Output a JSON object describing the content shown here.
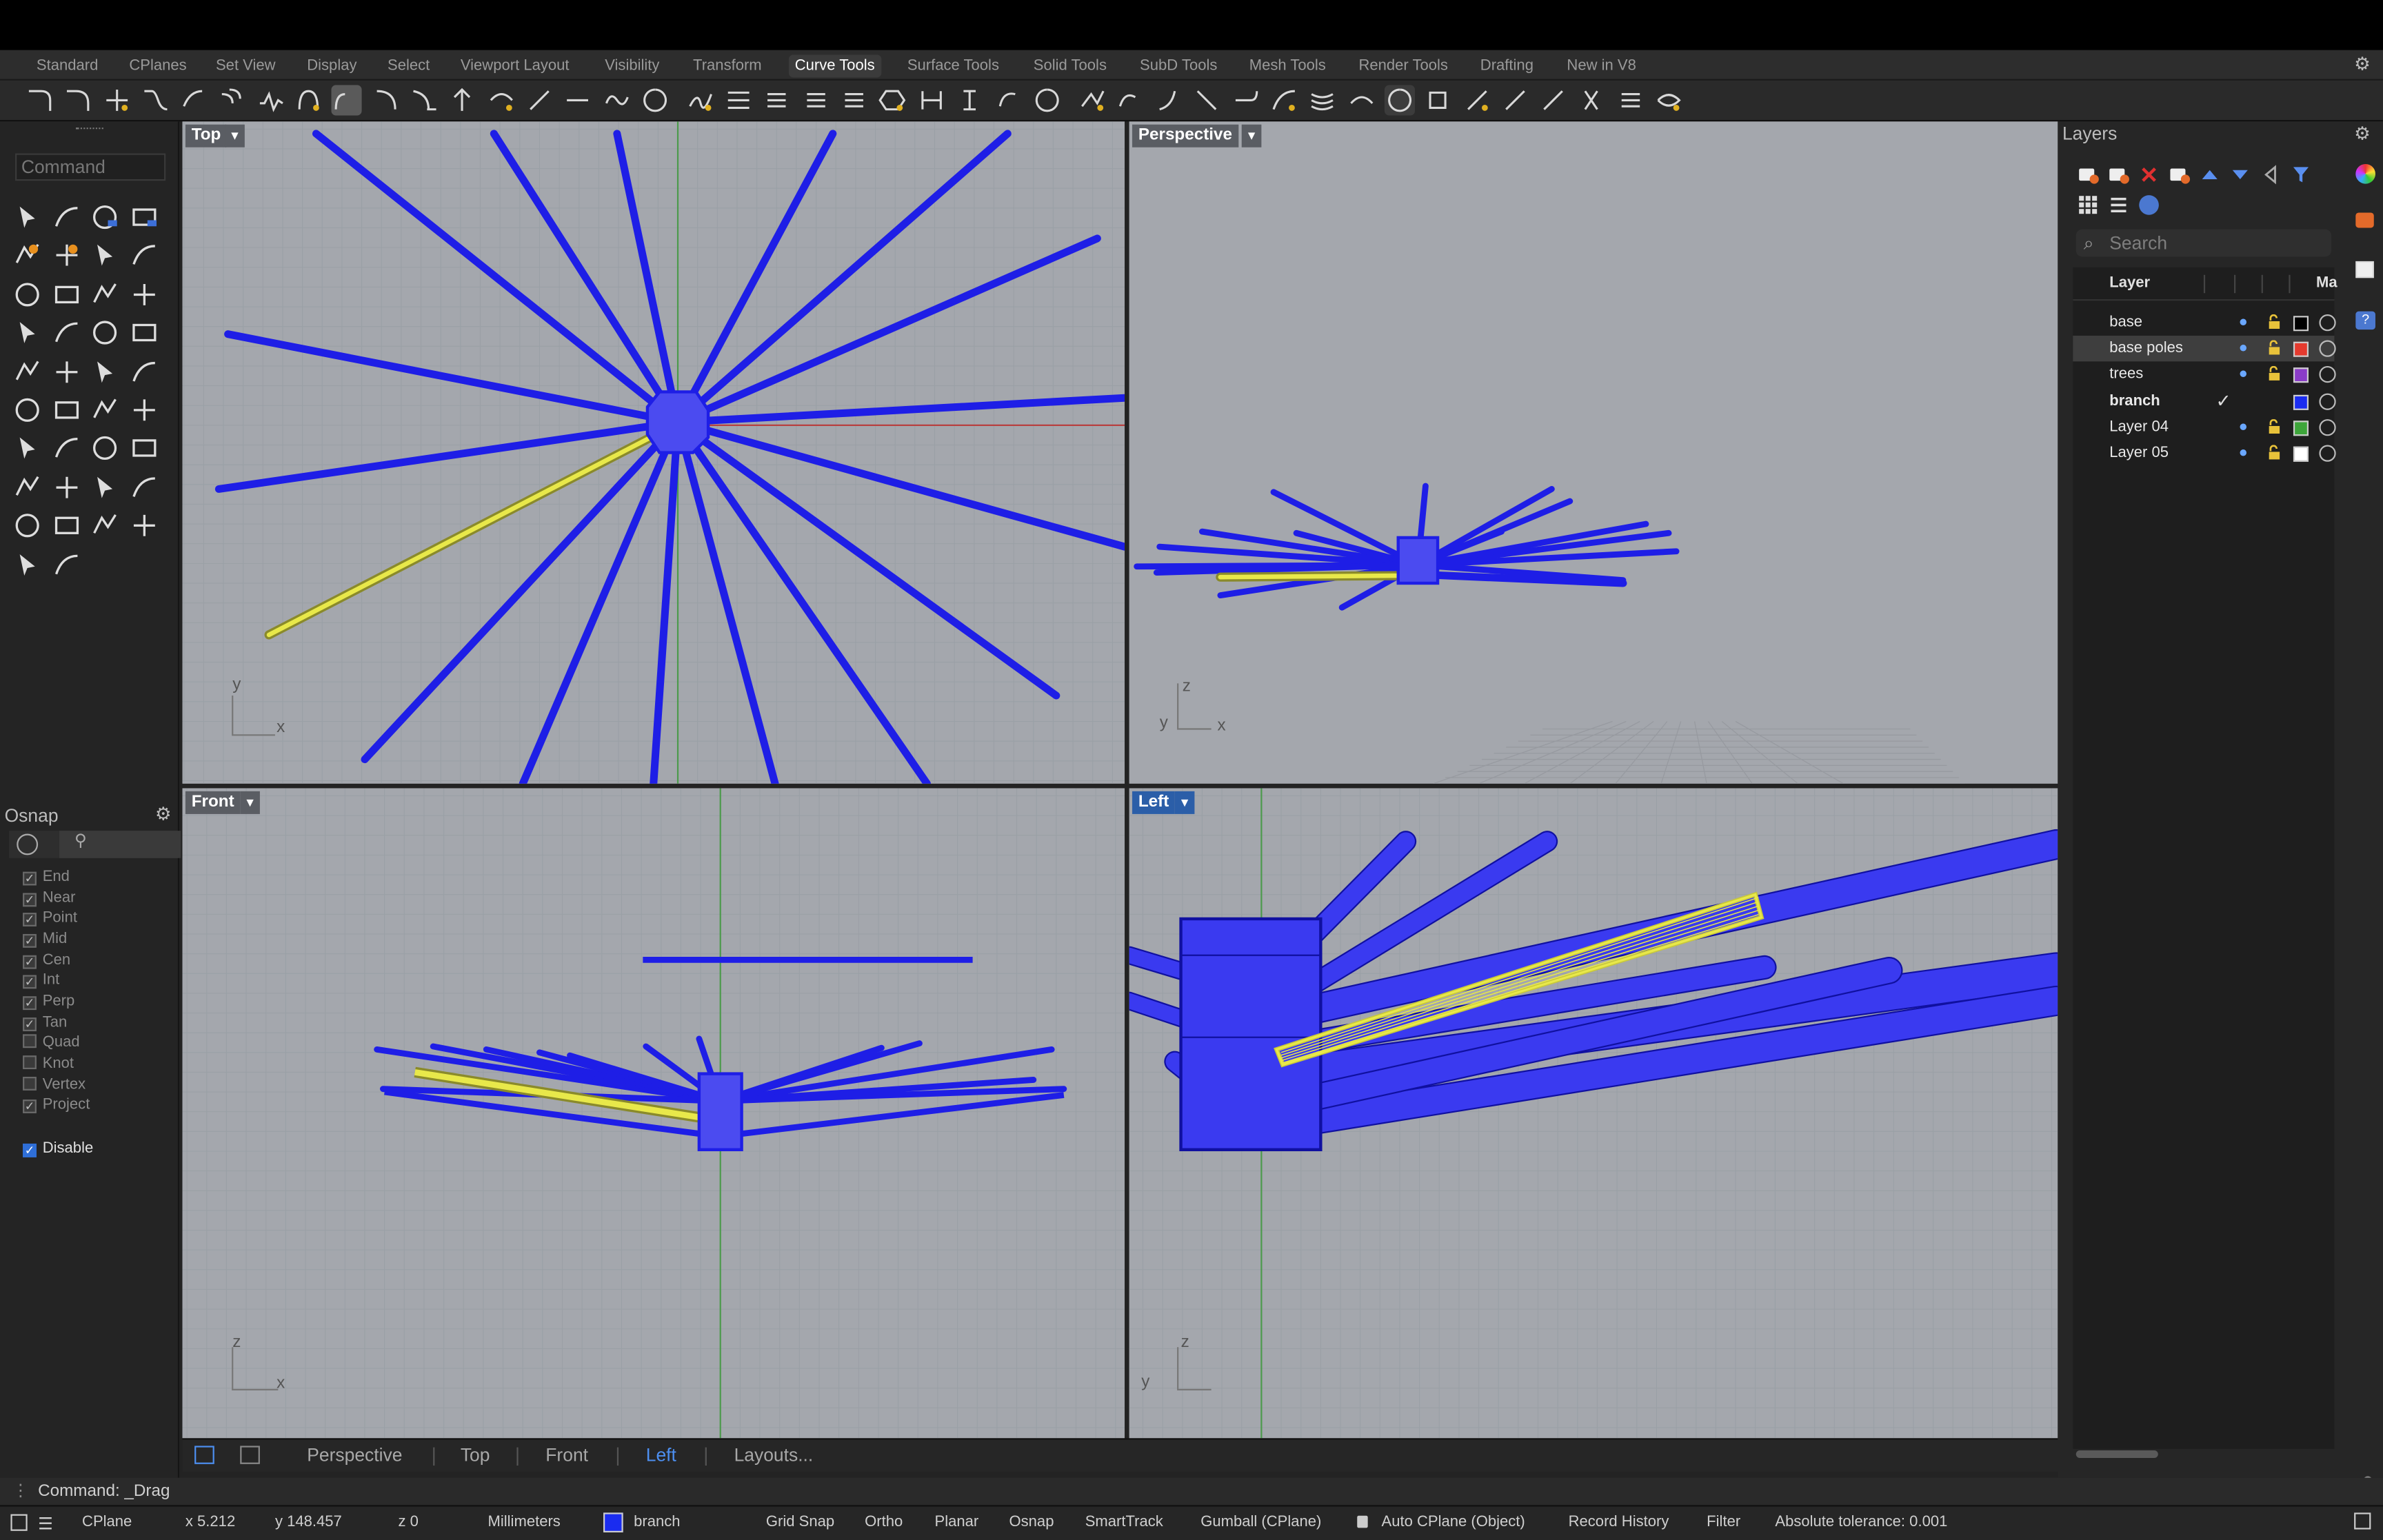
{
  "menu_tabs": [
    "Standard",
    "CPlanes",
    "Set View",
    "Display",
    "Select",
    "Viewport Layout",
    "Visibility",
    "Transform",
    "Curve Tools",
    "Surface Tools",
    "Solid Tools",
    "SubD Tools",
    "Mesh Tools",
    "Render Tools",
    "Drafting",
    "New in V8"
  ],
  "active_tab": "Curve Tools",
  "command_placeholder": "Command",
  "toolbar_icons": [
    "fillet-curves-icon",
    "chamfer-curves-icon",
    "connect-icon",
    "blend-curves-icon",
    "adjustable-blend-icon",
    "offset-curve-icon",
    "curve-from-2-views-icon",
    "arc-blend-icon",
    "match-curve-icon",
    "curve-boolean-icon",
    "extend-curve-icon",
    "project-icon",
    "pull-icon",
    "duplicate-edge-icon",
    "dash-icon",
    "curvature-graph-icon",
    "control-point-icon",
    "rebuild-curve-icon",
    "change-degree-icon",
    "fit-curve-icon",
    "simplify-icon",
    "fair-icon",
    "make-periodic-icon",
    "tween-curves-icon",
    "dimension-icon",
    "curve-direction-icon",
    "curve-end-icon",
    "seam-icon",
    "curve-edit-icon",
    "trim-icon",
    "split-icon",
    "extend-icon",
    "smooth-icon",
    "contour-icon",
    "section-icon",
    "curve-analysis-icon",
    "cylinder-curve-icon",
    "pipe-icon",
    "line-icon",
    "pen-icon",
    "network-icon",
    "spacing-icon",
    "loop-icon"
  ],
  "osnap": {
    "title": "Osnap",
    "items": [
      {
        "label": "End",
        "checked": true
      },
      {
        "label": "Near",
        "checked": true
      },
      {
        "label": "Point",
        "checked": true
      },
      {
        "label": "Mid",
        "checked": true
      },
      {
        "label": "Cen",
        "checked": true
      },
      {
        "label": "Int",
        "checked": true
      },
      {
        "label": "Perp",
        "checked": true
      },
      {
        "label": "Tan",
        "checked": true
      },
      {
        "label": "Quad",
        "checked": false
      },
      {
        "label": "Knot",
        "checked": false
      },
      {
        "label": "Vertex",
        "checked": false
      },
      {
        "label": "Project",
        "checked": true
      }
    ],
    "disable_label": "Disable",
    "disable_checked": true
  },
  "viewports": {
    "top": {
      "label": "Top",
      "axis_y": "y",
      "axis_x": "x"
    },
    "perspective": {
      "label": "Perspective",
      "axis_z": "z",
      "axis_y": "y",
      "axis_x": "x"
    },
    "front": {
      "label": "Front",
      "axis_z": "z",
      "axis_x": "x"
    },
    "left": {
      "label": "Left",
      "axis_z": "z",
      "axis_y": "y"
    }
  },
  "viewport_tabs": [
    "Perspective",
    "Top",
    "Front",
    "Left",
    "Layouts..."
  ],
  "active_viewport_tab": "Left",
  "layers": {
    "title": "Layers",
    "search_placeholder": "Search",
    "column_layer": "Layer",
    "column_material": "Ma",
    "rows": [
      {
        "name": "base",
        "color": "#000000",
        "current": false,
        "selected": false
      },
      {
        "name": "base poles",
        "color": "#e63a2e",
        "current": false,
        "selected": true
      },
      {
        "name": "trees",
        "color": "#8a3cc8",
        "current": false,
        "selected": false
      },
      {
        "name": "branch",
        "color": "#1a2cf0",
        "current": true,
        "selected": false
      },
      {
        "name": "Layer 04",
        "color": "#3da63a",
        "current": false,
        "selected": false
      },
      {
        "name": "Layer 05",
        "color": "#ffffff",
        "current": false,
        "selected": false
      }
    ]
  },
  "command_line": "Command: _Drag",
  "status": {
    "cplane": "CPlane",
    "x": "x 5.212",
    "y": "y 148.457",
    "z": "z 0",
    "units": "Millimeters",
    "layer_name": "branch",
    "layer_color": "#1a2cf0",
    "grid_snap": "Grid Snap",
    "ortho": "Ortho",
    "planar": "Planar",
    "osnap": "Osnap",
    "smarttrack": "SmartTrack",
    "gumball": "Gumball (CPlane)",
    "auto_cplane": "Auto CPlane (Object)",
    "record_history": "Record History",
    "filter": "Filter",
    "tolerance": "Absolute tolerance: 0.001"
  },
  "colors": {
    "object_blue": "#1e1ee6",
    "selected_yellow": "#e8e84a",
    "viewport_bg": "#a4a7ad",
    "active_label": "#2b5ea8"
  }
}
